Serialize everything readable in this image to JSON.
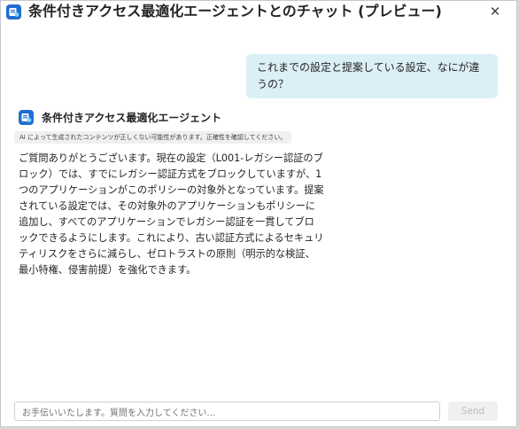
{
  "header": {
    "title": "条件付きアクセス最適化エージェントとのチャット (プレビュー)",
    "close_symbol": "✕"
  },
  "app_icon": "agent-app-icon",
  "conversation": {
    "user_message": "これまでの設定と提案している設定、なにが違うの？",
    "agent": {
      "name": "条件付きアクセス最適化エージェント",
      "icon": "agent-app-icon",
      "ai_notice": "AI によって生成されたコンテンツが正しくない可能性があります。正確性を確認してください。",
      "response": "ご質問ありがとうございます。現在の設定（L001-レガシー認証のブロック）では、すでにレガシー認証方式をブロックしていますが、1つのアプリケーションがこのポリシーの対象外となっています。提案されている設定では、その対象外のアプリケーションもポリシーに追加し、すべてのアプリケーションでレガシー認証を一貫してブロックできるようにします。これにより、古い認証方式によるセキュリティリスクをさらに減らし、ゼロトラストの原則（明示的な検証、最小特権、侵害前提）を強化できます。"
    }
  },
  "composer": {
    "placeholder": "お手伝いいたします。質問を入力してください...",
    "value": "",
    "send_label": "Send",
    "send_enabled": false
  },
  "colors": {
    "brand": "#1f6fd0",
    "user_bubble": "#dbeff6"
  }
}
